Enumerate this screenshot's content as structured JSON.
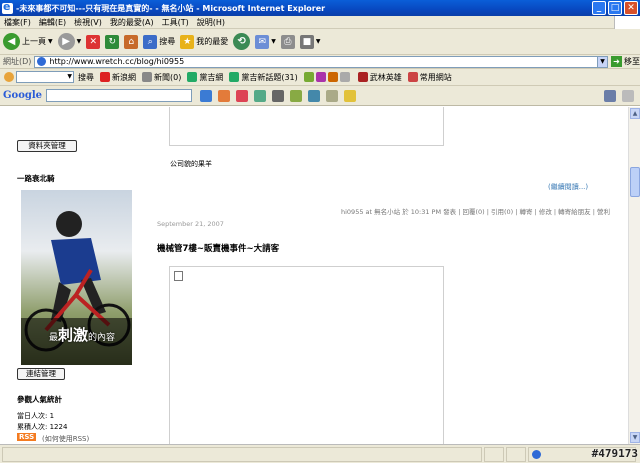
{
  "window": {
    "title": "-未來事都不可知---只有現在是真實的- - 無名小站 - Microsoft Internet Explorer"
  },
  "menu": [
    "檔案(F)",
    "編輯(E)",
    "檢視(V)",
    "我的最愛(A)",
    "工具(T)",
    "說明(H)"
  ],
  "toolbar": {
    "back": "上一頁",
    "search": "搜尋",
    "favorites": "我的最愛"
  },
  "address": {
    "label": "網址(D)",
    "url": "http://www.wretch.cc/blog/hi0955",
    "go": "移至"
  },
  "links": {
    "search": "搜尋",
    "items": [
      "新浪網",
      "新聞(0)",
      "黨吉網",
      "黨吉新話題(31)",
      "武林英雄",
      "常用網站"
    ]
  },
  "google": {
    "logo": "Google"
  },
  "sidebar": {
    "folder_button": "資料夾管理",
    "section_title": "一路衰北騎",
    "photo_caption_big": "刺激",
    "photo_caption_pre": "最",
    "photo_caption_post": "的內容",
    "link_button": "連結管理",
    "stats_title": "參觀人氣統計",
    "today": "當日人次: 1",
    "total": "累積人次: 1224",
    "rss_badge": "RSS",
    "rss_text": "(如何使用RSS)"
  },
  "post1": {
    "caption": "公司貌的果羊",
    "more": "(繼續閱讀...)",
    "footer": "hi0955 at 無名小站 於 10:31 PM 發表 | 回覆(0) | 引用(0) | 轉寄 | 修改 | 轉寄給朋友 | 營利"
  },
  "post2": {
    "date": "September 21, 2007",
    "title": "機械管7樓~販賣機事件~大請客"
  },
  "status": {
    "watermark": "#479173"
  }
}
